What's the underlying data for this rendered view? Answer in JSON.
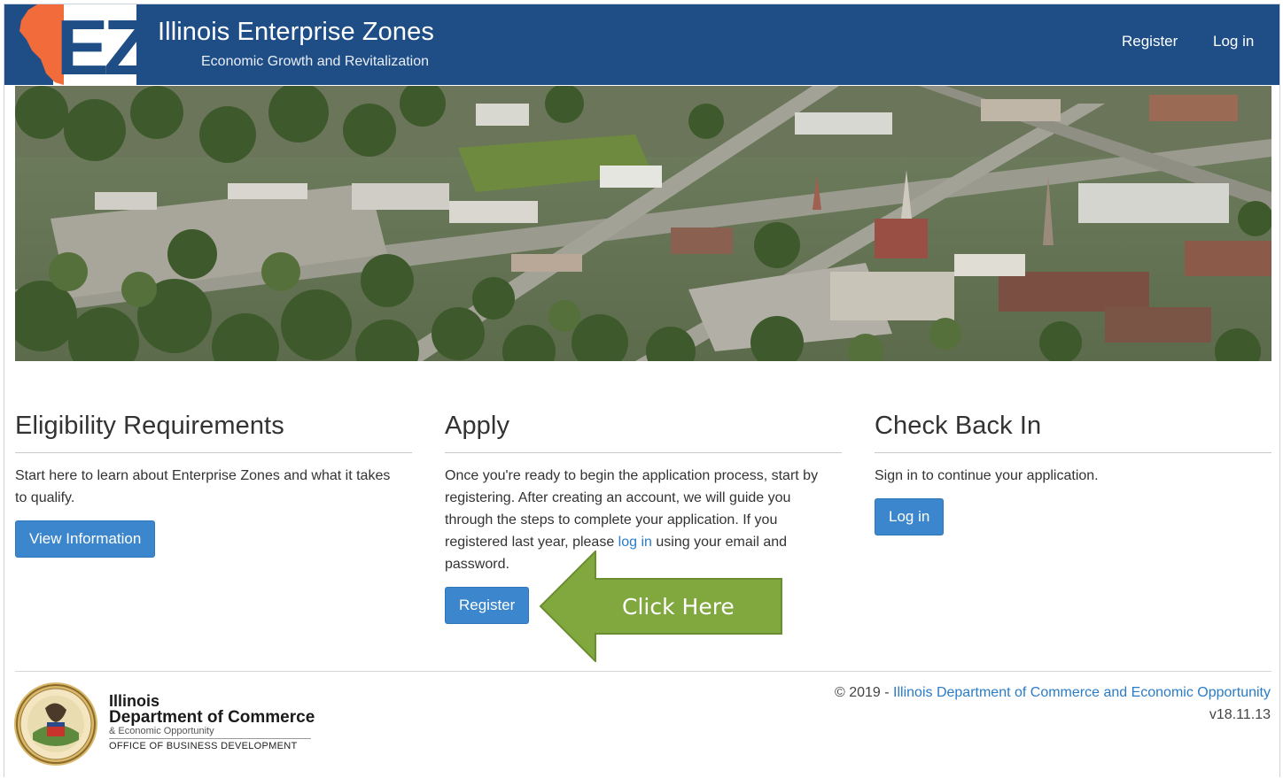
{
  "header": {
    "logo_text": "EZ",
    "title": "Illinois Enterprise Zones",
    "subtitle": "Economic Growth and Revitalization",
    "nav": {
      "register": "Register",
      "login": "Log in"
    }
  },
  "colors": {
    "navbar": "#1f4e87",
    "logo_orange": "#f26b3a",
    "button": "#3b86cc",
    "link": "#2a7cc7",
    "callout_green": "#80a83e"
  },
  "sections": {
    "eligibility": {
      "heading": "Eligibility Requirements",
      "body": "Start here to learn about Enterprise Zones and what it takes to qualify.",
      "button": "View Information"
    },
    "apply": {
      "heading": "Apply",
      "body_before": "Once you're ready to begin the application process, start by registering. After creating an account, we will guide you through the steps to complete your application. If you registered last year, please ",
      "link": "log in",
      "body_after": " using your email and password.",
      "button": "Register"
    },
    "checkback": {
      "heading": "Check Back In",
      "body": "Sign in to continue your application.",
      "button": "Log in"
    }
  },
  "callout": {
    "text": "Click Here"
  },
  "footer": {
    "dept_line1": "Illinois",
    "dept_line2": "Department of Commerce",
    "dept_line3": "& Economic Opportunity",
    "dept_line4": "OFFICE OF BUSINESS DEVELOPMENT",
    "copyright_prefix": "© 2019 - ",
    "copyright_link": "Illinois Department of Commerce and Economic Opportunity",
    "version": "v18.11.13"
  }
}
